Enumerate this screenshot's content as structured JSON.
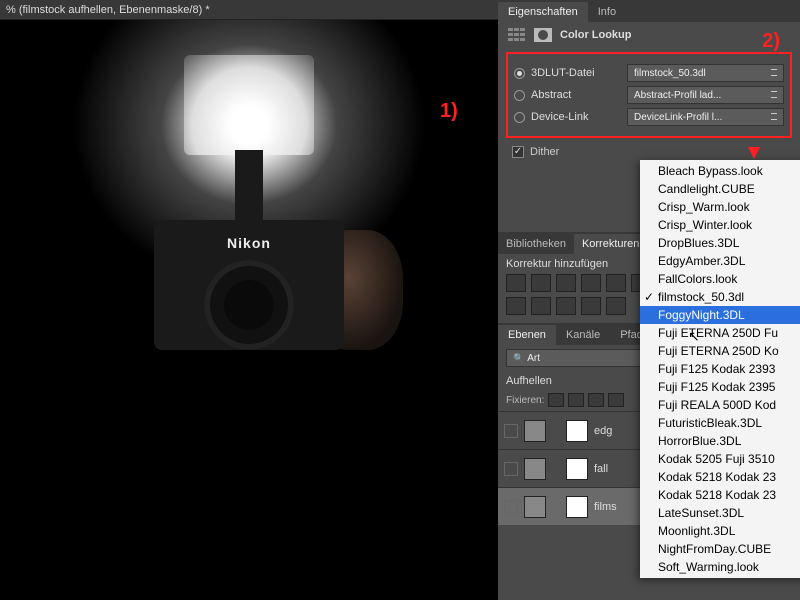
{
  "doc_tab": "% (filmstock aufhellen, Ebenenmaske/8) *",
  "camera_brand": "Nikon",
  "annotations": {
    "one": "1)",
    "two": "2)"
  },
  "props_panel": {
    "tabs": {
      "eigenschaften": "Eigenschaften",
      "info": "Info"
    },
    "title": "Color Lookup",
    "options": {
      "lut_file": {
        "label": "3DLUT-Datei",
        "value": "filmstock_50.3dl"
      },
      "abstract": {
        "label": "Abstract",
        "value": "Abstract-Profil lad..."
      },
      "device_link": {
        "label": "Device-Link",
        "value": "DeviceLink-Profil l..."
      }
    },
    "dither": "Dither"
  },
  "mid_tabs": {
    "bibliotheken": "Bibliotheken",
    "korrekturen": "Korrekturen"
  },
  "adjustments_title": "Korrektur hinzufügen",
  "layer_tabs": {
    "ebenen": "Ebenen",
    "kanaele": "Kanäle",
    "pfade": "Pfade"
  },
  "blend_search": "Art",
  "blend_mode": "Aufhellen",
  "lock_label": "Fixieren:",
  "layers": [
    {
      "name": "edg"
    },
    {
      "name": "fall"
    },
    {
      "name": "films"
    }
  ],
  "lut_menu": [
    "Bleach Bypass.look",
    "Candlelight.CUBE",
    "Crisp_Warm.look",
    "Crisp_Winter.look",
    "DropBlues.3DL",
    "EdgyAmber.3DL",
    "FallColors.look",
    "filmstock_50.3dl",
    "FoggyNight.3DL",
    "Fuji ETERNA 250D Fu",
    "Fuji ETERNA 250D Ko",
    "Fuji F125 Kodak 2393",
    "Fuji F125 Kodak 2395",
    "Fuji REALA 500D Kod",
    "FuturisticBleak.3DL",
    "HorrorBlue.3DL",
    "Kodak 5205 Fuji 3510",
    "Kodak 5218 Kodak 23",
    "Kodak 5218 Kodak 23",
    "LateSunset.3DL",
    "Moonlight.3DL",
    "NightFromDay.CUBE",
    "Soft_Warming.look"
  ],
  "lut_checked_index": 7,
  "lut_highlight_index": 8
}
